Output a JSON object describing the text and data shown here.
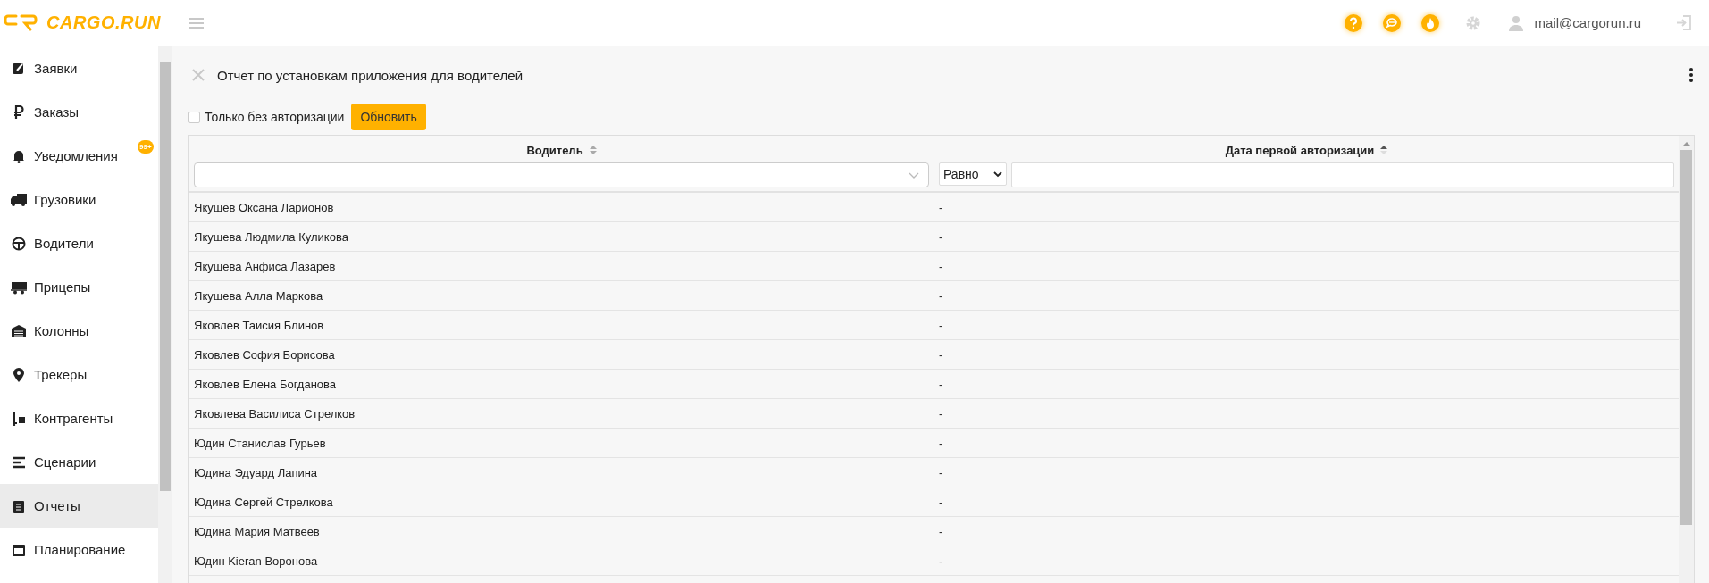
{
  "header": {
    "logo": "CARGO.RUN",
    "user_email": "mail@cargorun.ru"
  },
  "sidebar": {
    "items": [
      {
        "label": "Заявки",
        "selected": false
      },
      {
        "label": "Заказы",
        "selected": false
      },
      {
        "label": "Уведомления",
        "selected": false,
        "badge": "99+"
      },
      {
        "label": "Грузовики",
        "selected": false
      },
      {
        "label": "Водители",
        "selected": false
      },
      {
        "label": "Прицепы",
        "selected": false
      },
      {
        "label": "Колонны",
        "selected": false
      },
      {
        "label": "Трекеры",
        "selected": false
      },
      {
        "label": "Контрагенты",
        "selected": false
      },
      {
        "label": "Сценарии",
        "selected": false
      },
      {
        "label": "Отчеты",
        "selected": true
      },
      {
        "label": "Планирование",
        "selected": false
      }
    ]
  },
  "report": {
    "title": "Отчет по установкам приложения для водителей",
    "filter_checkbox": {
      "label": "Только без авторизации",
      "checked": false
    },
    "refresh_button": "Обновить",
    "table": {
      "columns": [
        {
          "title": "Водитель",
          "sorted_ascending": false,
          "kind": "dropdown"
        },
        {
          "title": "Дата первой авторизации",
          "sorted_ascending": true,
          "kind": "operator",
          "operator": "Равно"
        }
      ],
      "rows": [
        [
          "Якушев Оксана Ларионов",
          "-"
        ],
        [
          "Якушева Людмила Куликова",
          "-"
        ],
        [
          "Якушева Анфиса Лазарев",
          "-"
        ],
        [
          "Якушева Алла Маркова",
          "-"
        ],
        [
          "Яковлев Таисия Блинов",
          "-"
        ],
        [
          "Яковлев София Борисова",
          "-"
        ],
        [
          "Яковлев Елена Богданова",
          "-"
        ],
        [
          "Яковлева Василиса Стрелков",
          "-"
        ],
        [
          "Юдин Станислав Гурьев",
          "-"
        ],
        [
          "Юдина Эдуард Лапина",
          "-"
        ],
        [
          "Юдина Сергей Стрелкова",
          "-"
        ],
        [
          "Юдина Мария Матвеев",
          "-"
        ],
        [
          "Юдин Kieran Воронова",
          "-"
        ]
      ]
    }
  }
}
